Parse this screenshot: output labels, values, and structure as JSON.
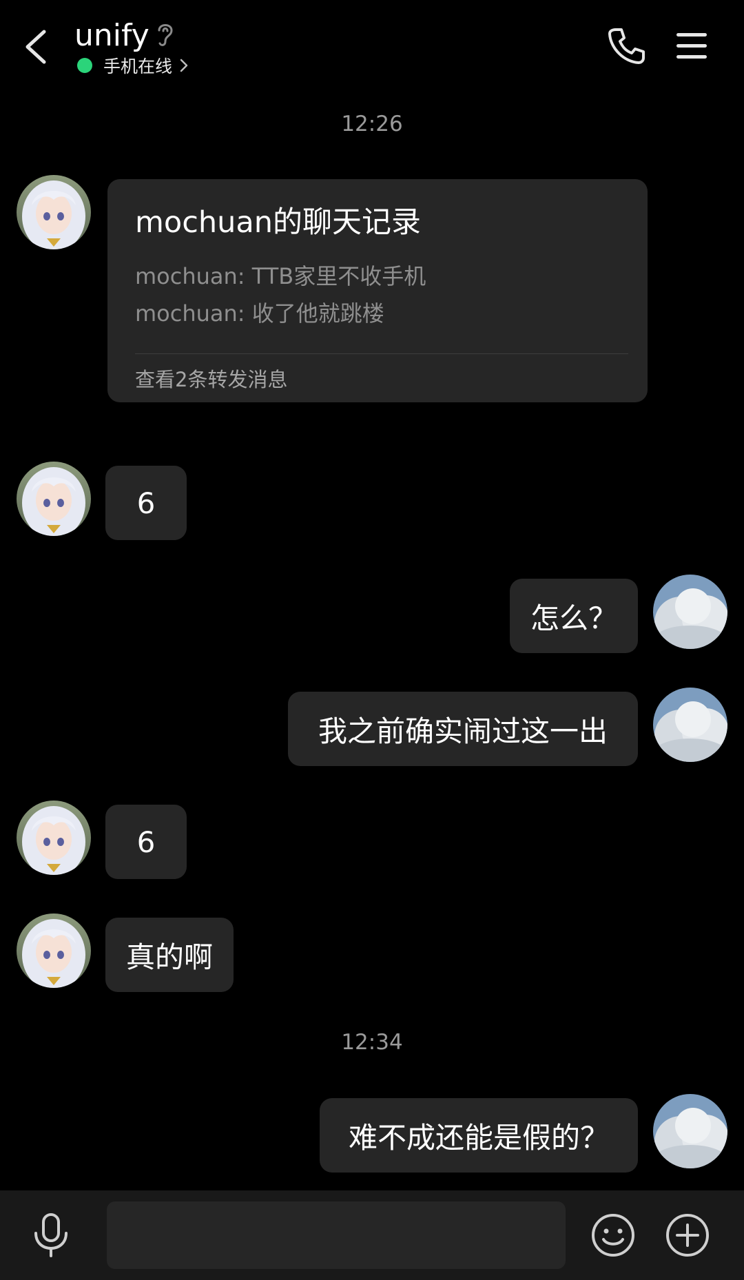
{
  "header": {
    "title": "unify",
    "status": "手机在线"
  },
  "timestamps": [
    "12:26",
    "12:34"
  ],
  "forwarded": {
    "title": "mochuan的聊天记录",
    "lines": [
      "mochuan: TTB家里不收手机",
      "mochuan: 收了他就跳楼"
    ],
    "footer": "查看2条转发消息"
  },
  "messages": [
    {
      "side": "left",
      "text": "6"
    },
    {
      "side": "right",
      "text": "怎么？"
    },
    {
      "side": "right",
      "text": "我之前确实闹过这一出"
    },
    {
      "side": "left",
      "text": "6"
    },
    {
      "side": "left",
      "text": "真的啊"
    },
    {
      "side": "right",
      "text": "难不成还能是假的？"
    }
  ],
  "input": {
    "value": "",
    "placeholder": ""
  },
  "icons": {
    "back": "back-arrow-icon",
    "ear": "ear-icon",
    "phone": "phone-icon",
    "menu": "menu-icon",
    "voice": "microphone-icon",
    "emoji": "emoji-icon",
    "plus": "plus-icon"
  },
  "colors": {
    "background": "#000000",
    "bubble": "#262626",
    "online_dot": "#2bd47a",
    "muted_text": "#9a9a9a"
  }
}
